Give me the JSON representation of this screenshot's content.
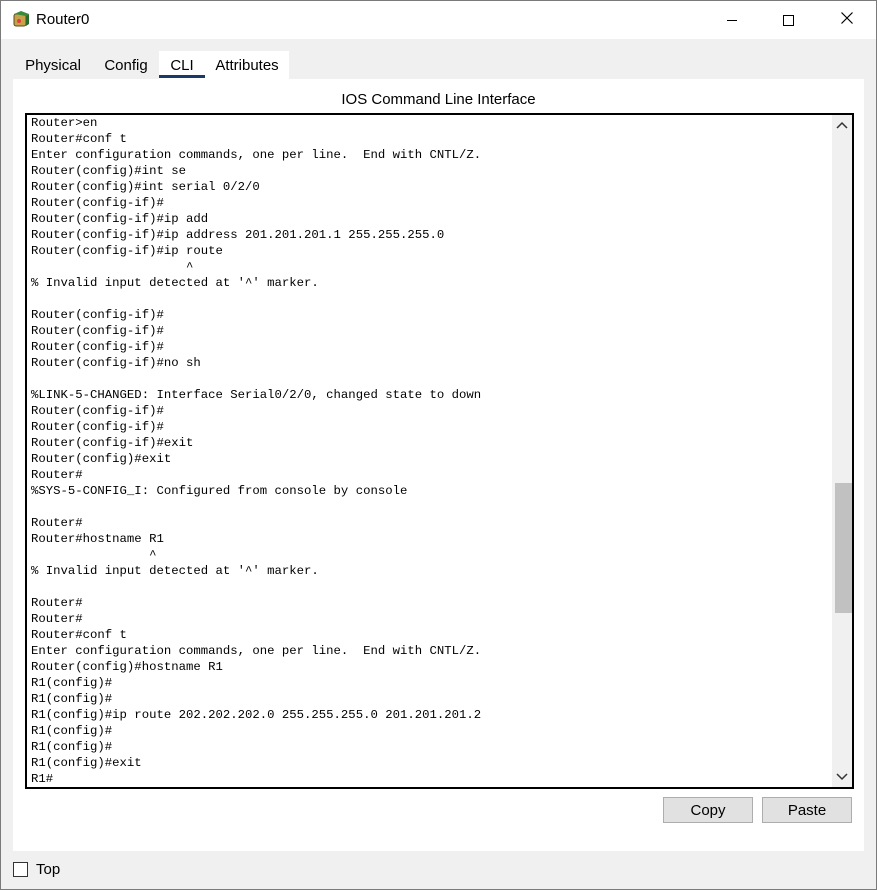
{
  "window": {
    "title": "Router0",
    "minimize_icon": "minimize-icon",
    "maximize_icon": "maximize-icon",
    "close_icon": "close-icon",
    "app_icon": "router-app-icon"
  },
  "tabs": [
    {
      "label": "Physical",
      "active": false
    },
    {
      "label": "Config",
      "active": false
    },
    {
      "label": "CLI",
      "active": true
    },
    {
      "label": "Attributes",
      "active": false
    }
  ],
  "panel": {
    "title": "IOS Command Line Interface"
  },
  "terminal": {
    "lines": [
      "Router>en",
      "Router#conf t",
      "Enter configuration commands, one per line.  End with CNTL/Z.",
      "Router(config)#int se",
      "Router(config)#int serial 0/2/0",
      "Router(config-if)#",
      "Router(config-if)#ip add",
      "Router(config-if)#ip address 201.201.201.1 255.255.255.0",
      "Router(config-if)#ip route",
      "                     ^",
      "% Invalid input detected at '^' marker.",
      "",
      "Router(config-if)#",
      "Router(config-if)#",
      "Router(config-if)#",
      "Router(config-if)#no sh",
      "",
      "%LINK-5-CHANGED: Interface Serial0/2/0, changed state to down",
      "Router(config-if)#",
      "Router(config-if)#",
      "Router(config-if)#exit",
      "Router(config)#exit",
      "Router#",
      "%SYS-5-CONFIG_I: Configured from console by console",
      "",
      "Router#",
      "Router#hostname R1",
      "                ^",
      "% Invalid input detected at '^' marker.",
      "",
      "Router#",
      "Router#",
      "Router#conf t",
      "Enter configuration commands, one per line.  End with CNTL/Z.",
      "Router(config)#hostname R1",
      "R1(config)#",
      "R1(config)#",
      "R1(config)#ip route 202.202.202.0 255.255.255.0 201.201.201.2",
      "R1(config)#",
      "R1(config)#",
      "R1(config)#exit",
      "R1#"
    ],
    "scroll_up_icon": "chevron-up-icon",
    "scroll_down_icon": "chevron-down-icon"
  },
  "buttons": {
    "copy": "Copy",
    "paste": "Paste"
  },
  "footer": {
    "top_label": "Top",
    "top_checked": false
  }
}
